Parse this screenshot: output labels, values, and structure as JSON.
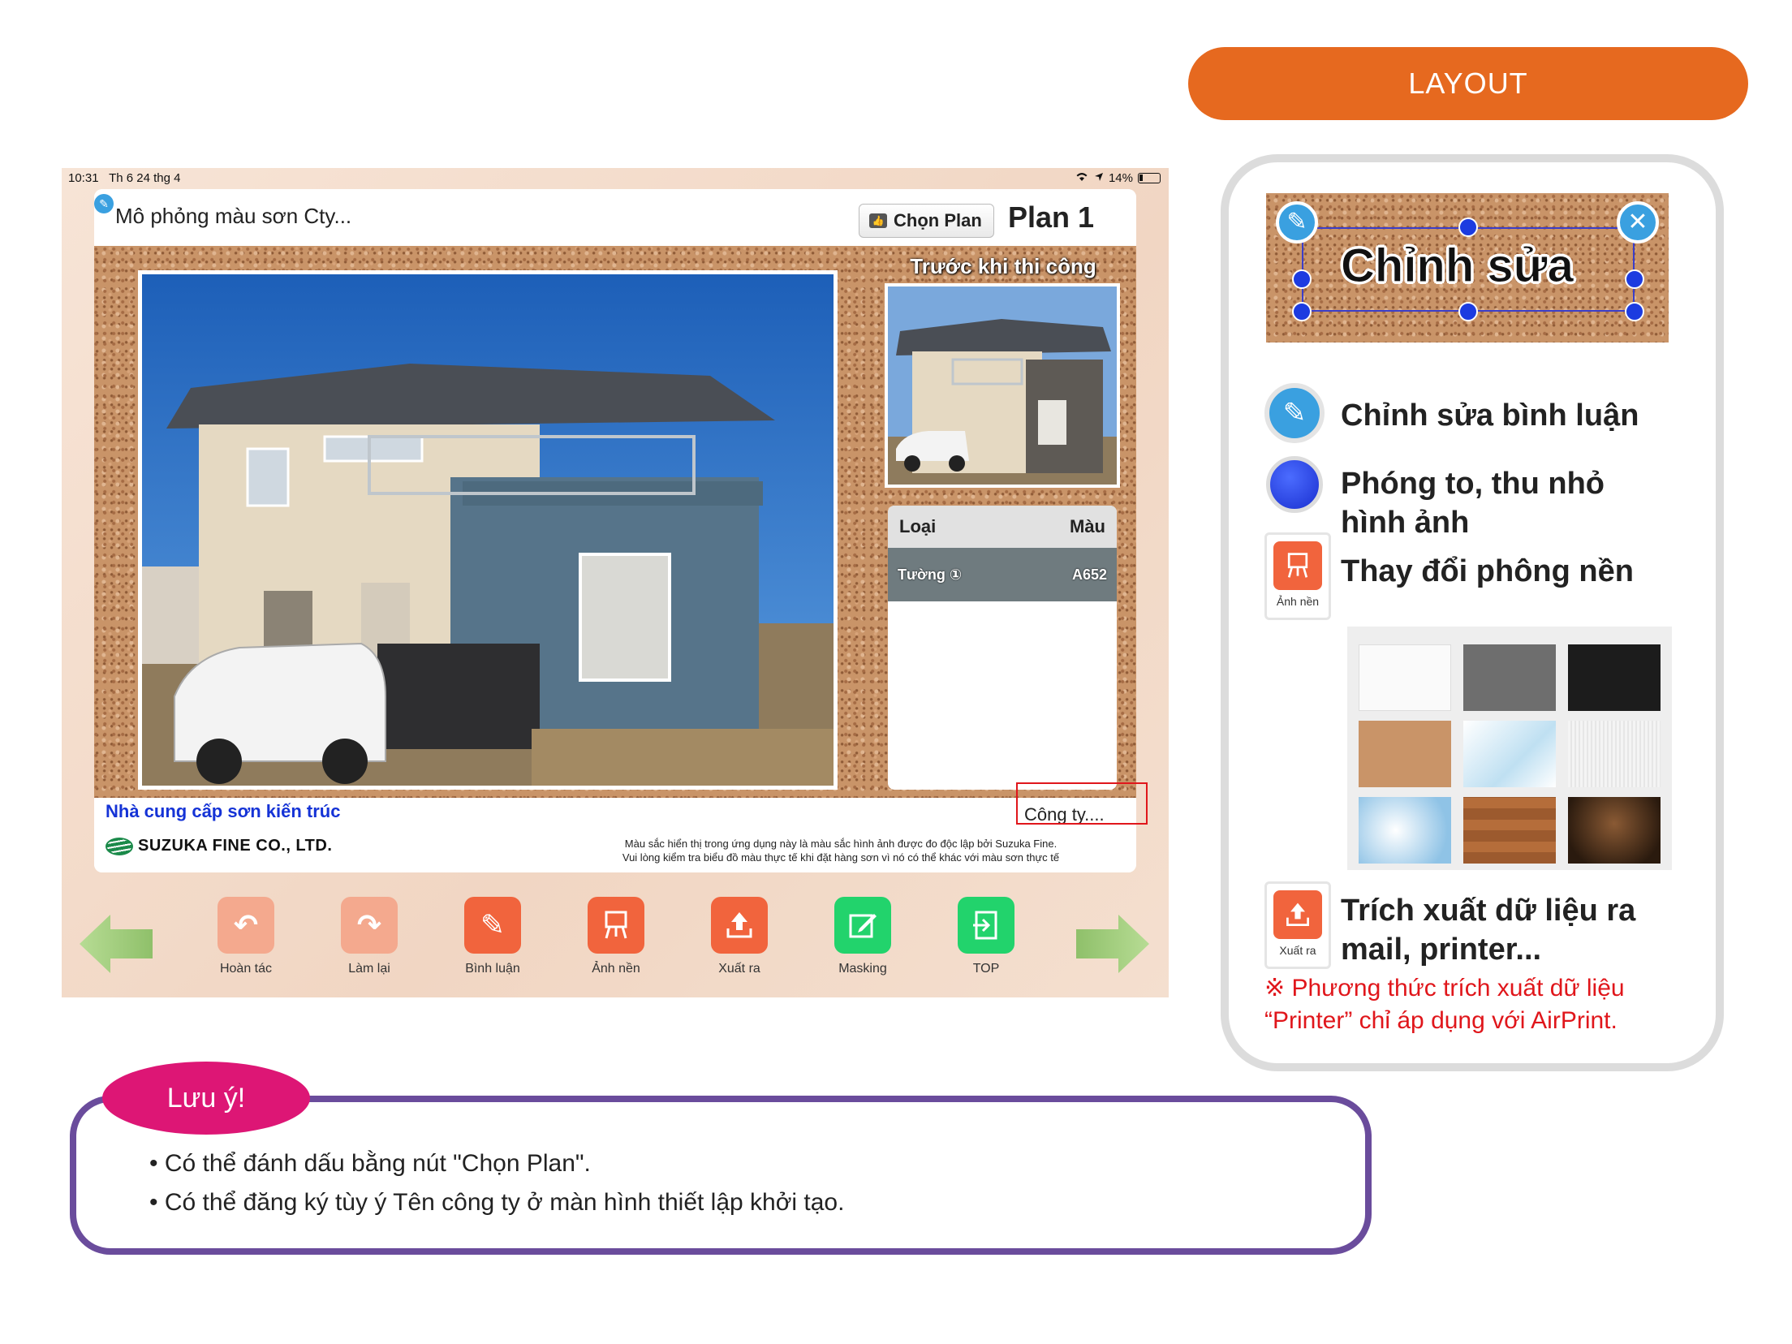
{
  "ipad": {
    "status": {
      "time": "10:31",
      "date": "Th 6 24 thg 4",
      "battery": "14%"
    },
    "title_bar": {
      "project_title": "Mô phỏng màu sơn Cty...",
      "choose_plan_label": "Chọn Plan",
      "plan_name": "Plan 1"
    },
    "before_label": "Trước khi thi công",
    "color_table": {
      "headers": [
        "Loại",
        "Màu"
      ],
      "rows": [
        {
          "type": "Tường ①",
          "color": "A652"
        }
      ]
    },
    "footer": {
      "supplier_label": "Nhà cung cấp sơn kiến trúc",
      "company_name": "Công ty....",
      "logo_text": "SUZUKA FINE CO., LTD.",
      "disclaimer_line1": "Màu sắc hiển thị trong ứng dụng này là màu sắc hình ảnh được đo độc lập bởi Suzuka Fine.",
      "disclaimer_line2": "Vui lòng kiểm tra biểu đồ màu thực tế khi đặt hàng sơn vì nó có thể khác với màu sơn thực tế"
    },
    "toolbar": [
      {
        "label": "Hoàn tác",
        "icon": "undo-icon",
        "color": "#f4a98e"
      },
      {
        "label": "Làm lại",
        "icon": "redo-icon",
        "color": "#f4a98e"
      },
      {
        "label": "Bình luận",
        "icon": "pencil-icon",
        "color": "#f1643d"
      },
      {
        "label": "Ảnh nền",
        "icon": "easel-icon",
        "color": "#f1643d"
      },
      {
        "label": "Xuất ra",
        "icon": "export-icon",
        "color": "#f1643d"
      },
      {
        "label": "Masking",
        "icon": "edit-square-icon",
        "color": "#22d36c"
      },
      {
        "label": "TOP",
        "icon": "exit-icon",
        "color": "#22d36c"
      }
    ]
  },
  "layout_panel": {
    "heading": "LAYOUT",
    "sample_text": "Chỉnh sửa",
    "edit_comment": "Chỉnh sửa bình luận",
    "zoom_line1": "Phóng to, thu nhỏ",
    "zoom_line2": "hình ảnh",
    "change_bg": "Thay đổi phông nền",
    "bg_icon_label": "Ảnh nền",
    "export_line1": "Trích xuất dữ liệu ra",
    "export_line2": "mail, printer...",
    "export_icon_label": "Xuất ra",
    "note_line1": "※ Phương thức trích xuất dữ liệu",
    "note_line2": "“Printer” chỉ áp dụng với AirPrint."
  },
  "notes": {
    "badge": "Lưu ý!",
    "items": [
      "Có thể đánh dấu bằng nút \"Chọn Plan\".",
      "Có thể đăng ký tùy ý Tên công ty ở màn hình thiết lập khởi tạo."
    ]
  },
  "colors": {
    "layout_orange": "#e6691f",
    "notes_purple": "#6a4c9c",
    "badge_pink": "#dd1675",
    "note_red": "#e0161b"
  }
}
